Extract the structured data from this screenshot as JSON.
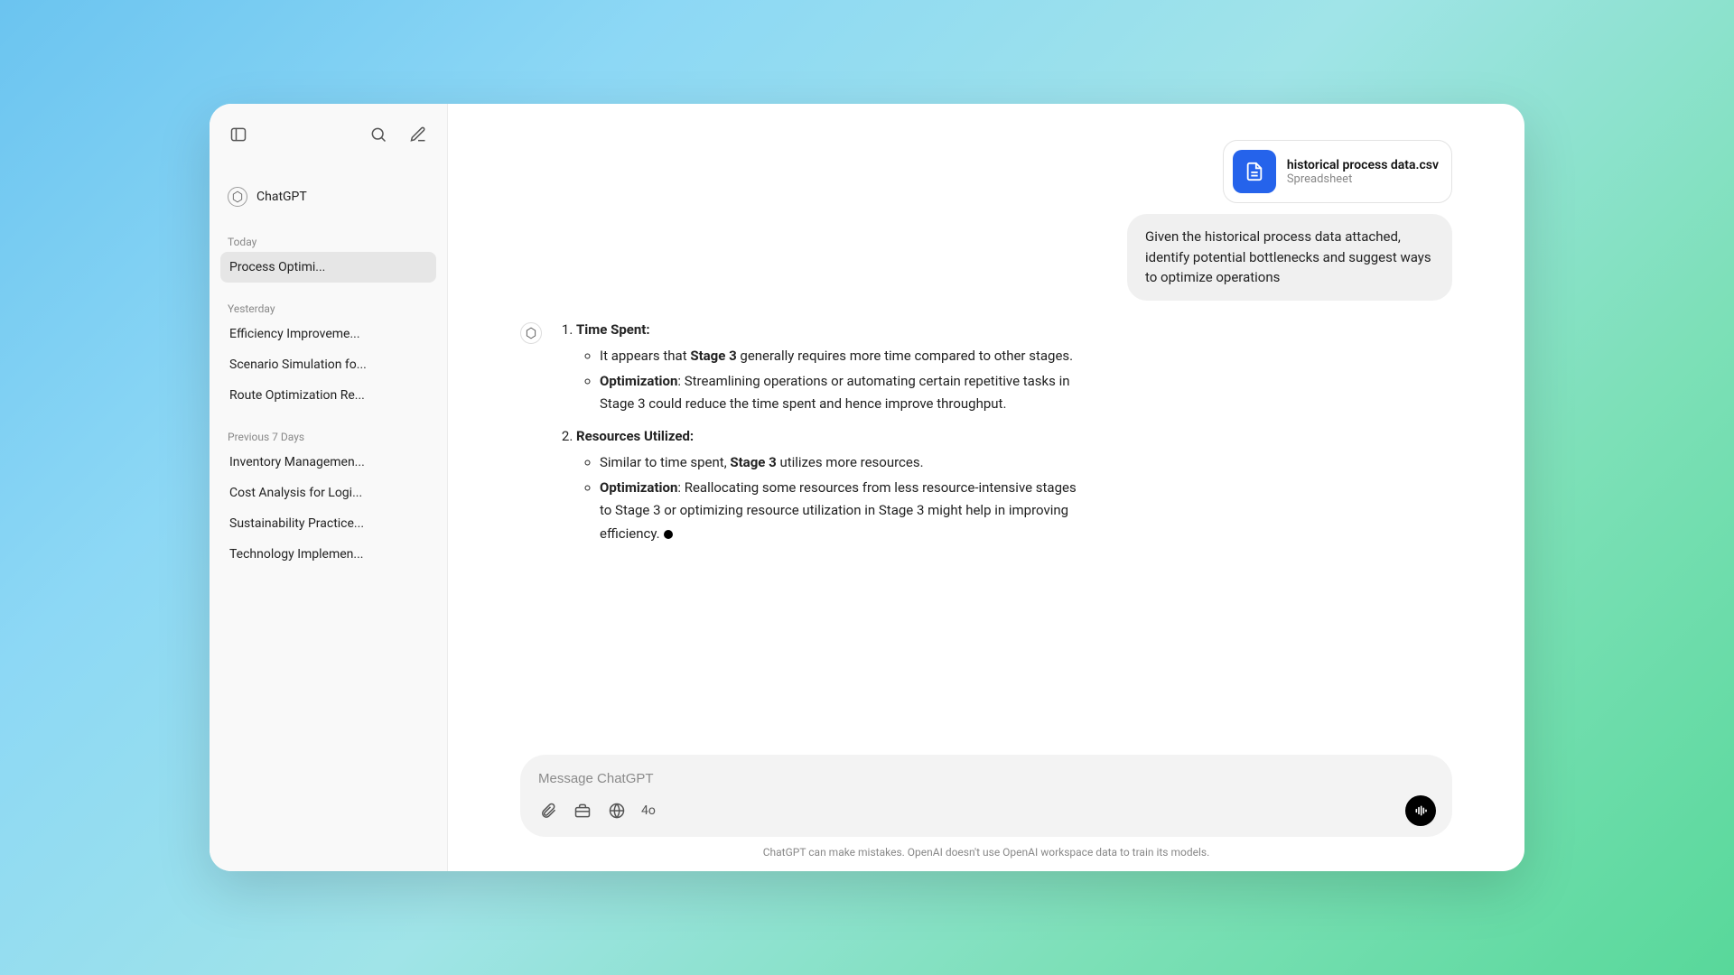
{
  "sidebar": {
    "brand_label": "ChatGPT",
    "sections": [
      {
        "heading": "Today",
        "items": [
          "Process Optimi..."
        ]
      },
      {
        "heading": "Yesterday",
        "items": [
          "Efficiency Improveme...",
          "Scenario Simulation fo...",
          "Route Optimization Re..."
        ]
      },
      {
        "heading": "Previous 7 Days",
        "items": [
          "Inventory Managemen...",
          "Cost Analysis for Logi...",
          "Sustainability Practice...",
          "Technology Implemen..."
        ]
      }
    ],
    "active_item": "Process Optimi..."
  },
  "chat": {
    "file": {
      "name": "historical process data.csv",
      "type": "Spreadsheet"
    },
    "user_message": "Given the historical process data attached, identify potential bottlenecks and suggest ways to optimize operations",
    "assistant": {
      "items": [
        {
          "title": "Time Spent:",
          "bullets": [
            {
              "prefix": "It appears that ",
              "bold": "Stage 3",
              "suffix": " generally requires more time compared to other stages."
            },
            {
              "bold": "Optimization",
              "suffix": ": Streamlining operations or automating certain repetitive tasks in Stage 3 could reduce the time spent and hence improve throughput."
            }
          ]
        },
        {
          "title": "Resources Utilized:",
          "bullets": [
            {
              "prefix": "Similar to time spent, ",
              "bold": "Stage 3",
              "suffix": " utilizes more resources."
            },
            {
              "bold": "Optimization",
              "suffix": ": Reallocating some resources from less resource-intensive stages to Stage 3 or optimizing resource utilization in Stage 3 might help in improving efficiency.",
              "cursor": true
            }
          ]
        }
      ]
    }
  },
  "composer": {
    "placeholder": "Message ChatGPT",
    "model": "4o"
  },
  "footer": "ChatGPT can make mistakes. OpenAI doesn't use OpenAI workspace data to train its models."
}
